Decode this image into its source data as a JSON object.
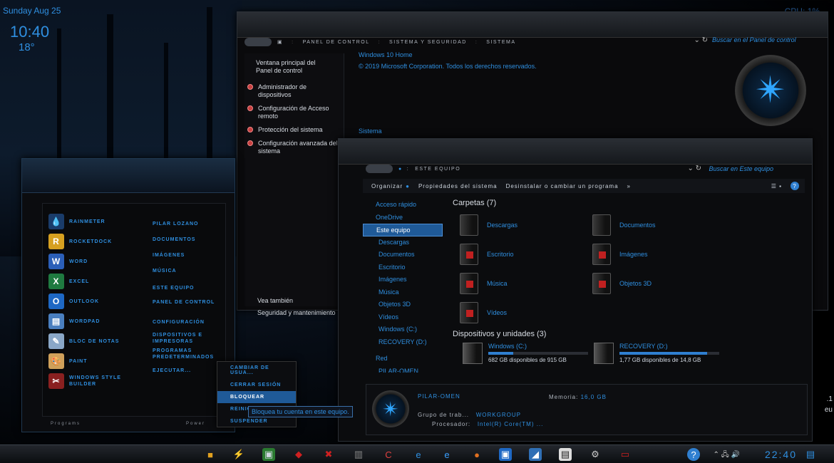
{
  "widget": {
    "date": "Sunday Aug 25",
    "time": "10:40",
    "temp": "18°",
    "cpu": "CPU: 1%"
  },
  "control_panel": {
    "breadcrumb": [
      "Panel de control",
      "Sistema y seguridad",
      "Sistema"
    ],
    "search_placeholder": "Buscar en el Panel de control",
    "home": "Ventana principal del Panel de control",
    "links": [
      "Administrador de dispositivos",
      "Configuración de Acceso remoto",
      "Protección del sistema",
      "Configuración avanzada del sistema"
    ],
    "edition": "Windows 10 Home",
    "copyright": "© 2019 Microsoft Corporation. Todos los derechos reservados.",
    "system_heading": "Sistema",
    "see_also": "Vea también",
    "see_also_link": "Seguridad y mantenimiento"
  },
  "start_menu": {
    "apps": [
      "Rainmeter",
      "RocketDock",
      "Word",
      "Excel",
      "Outlook",
      "WordPad",
      "Bloc de notas",
      "Paint",
      "Windows Style Builder"
    ],
    "places": [
      "Pilar Lozano",
      "Documentos",
      "Imágenes",
      "Música",
      "Este equipo",
      "Panel de control",
      "Configuración",
      "Dispositivos e impresoras",
      "Programas predeterminados",
      "Ejecutar..."
    ],
    "footer_programs": "Programs",
    "footer_power": "Power"
  },
  "power_menu": {
    "items": [
      "Cambiar de usua...",
      "Cerrar sesión",
      "Bloquear",
      "Reiniciar",
      "Suspender"
    ],
    "tooltip": "Bloquea tu cuenta en este equipo."
  },
  "explorer": {
    "path": "Este equipo",
    "search_placeholder": "Buscar en Este equipo",
    "toolbar": [
      "Organizar",
      "Propiedades del sistema",
      "Desinstalar o cambiar un programa",
      "»"
    ],
    "nav": [
      "Acceso rápido",
      "OneDrive",
      "Este equipo",
      "Descargas",
      "Documentos",
      "Escritorio",
      "Imágenes",
      "Música",
      "Objetos 3D",
      "Vídeos",
      "Windows (C:)",
      "RECOVERY (D:)",
      "Red",
      "PILAR-OMEN"
    ],
    "folders_heading": "Carpetas (7)",
    "folders": [
      "Descargas",
      "Documentos",
      "Escritorio",
      "Imágenes",
      "Música",
      "Objetos 3D",
      "Vídeos"
    ],
    "drives_heading": "Dispositivos y unidades (3)",
    "drives": [
      {
        "name": "Windows (C:)",
        "free": "682 GB disponibles de 915 GB",
        "used_pct": 25
      },
      {
        "name": "RECOVERY (D:)",
        "free": "1,77 GB disponibles de 14,8 GB",
        "used_pct": 88
      }
    ],
    "details": {
      "computer": "PILAR-OMEN",
      "memory_label": "Memoria:",
      "memory": "16,0 GB",
      "workgroup_label": "Grupo de trab...",
      "workgroup": "WORKGROUP",
      "cpu_label": "Procesador:",
      "cpu": "Intel(R) Core(TM) ..."
    }
  },
  "side_text": [
    ".1",
    "eu"
  ],
  "taskbar": {
    "clock": "22:40"
  }
}
